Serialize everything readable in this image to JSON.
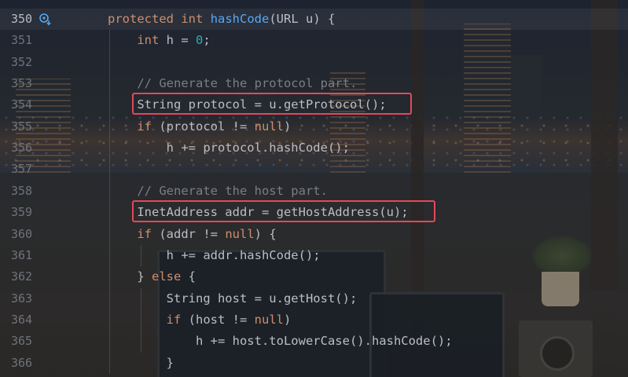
{
  "editor": {
    "lines": [
      {
        "num": "350",
        "tokens": [
          {
            "t": "protected",
            "c": "kw"
          },
          {
            "t": " "
          },
          {
            "t": "int",
            "c": "kw"
          },
          {
            "t": " "
          },
          {
            "t": "hashCode",
            "c": "fn"
          },
          {
            "t": "(URL u) {"
          }
        ]
      },
      {
        "num": "351",
        "tokens": [
          {
            "t": "    "
          },
          {
            "t": "int",
            "c": "kw"
          },
          {
            "t": " h = "
          },
          {
            "t": "0",
            "c": "num"
          },
          {
            "t": ";"
          }
        ]
      },
      {
        "num": "352",
        "tokens": []
      },
      {
        "num": "353",
        "tokens": [
          {
            "t": "    "
          },
          {
            "t": "// Generate the protocol part.",
            "c": "cm"
          }
        ]
      },
      {
        "num": "354",
        "tokens": [
          {
            "t": "    String protocol = u.getProtocol();"
          }
        ]
      },
      {
        "num": "355",
        "tokens": [
          {
            "t": "    "
          },
          {
            "t": "if",
            "c": "kw"
          },
          {
            "t": " (protocol != "
          },
          {
            "t": "null",
            "c": "kw"
          },
          {
            "t": ")"
          }
        ]
      },
      {
        "num": "356",
        "tokens": [
          {
            "t": "        h += protocol.hashCode();"
          }
        ]
      },
      {
        "num": "357",
        "tokens": []
      },
      {
        "num": "358",
        "tokens": [
          {
            "t": "    "
          },
          {
            "t": "// Generate the host part.",
            "c": "cm"
          }
        ]
      },
      {
        "num": "359",
        "tokens": [
          {
            "t": "    InetAddress addr = getHostAddress(u);"
          }
        ]
      },
      {
        "num": "360",
        "tokens": [
          {
            "t": "    "
          },
          {
            "t": "if",
            "c": "kw"
          },
          {
            "t": " (addr != "
          },
          {
            "t": "null",
            "c": "kw"
          },
          {
            "t": ") {"
          }
        ]
      },
      {
        "num": "361",
        "tokens": [
          {
            "t": "        h += addr.hashCode();"
          }
        ]
      },
      {
        "num": "362",
        "tokens": [
          {
            "t": "    } "
          },
          {
            "t": "else",
            "c": "kw"
          },
          {
            "t": " {"
          }
        ]
      },
      {
        "num": "363",
        "tokens": [
          {
            "t": "        String host = u.getHost();"
          }
        ]
      },
      {
        "num": "364",
        "tokens": [
          {
            "t": "        "
          },
          {
            "t": "if",
            "c": "kw"
          },
          {
            "t": " (host != "
          },
          {
            "t": "null",
            "c": "kw"
          },
          {
            "t": ")"
          }
        ]
      },
      {
        "num": "365",
        "tokens": [
          {
            "t": "            h += host.toLowerCase().hashCode();"
          }
        ]
      },
      {
        "num": "366",
        "tokens": [
          {
            "t": "        }"
          }
        ]
      }
    ],
    "current_line": "350",
    "gutter_icon": "override-method-icon",
    "highlight_lines": [
      "354",
      "359"
    ],
    "colors": {
      "keyword": "#cf8e6d",
      "function": "#56a8f5",
      "number": "#2aacb8",
      "comment": "#7a7e85",
      "text": "#bcbec4",
      "highlight_box": "#e4485a"
    }
  }
}
